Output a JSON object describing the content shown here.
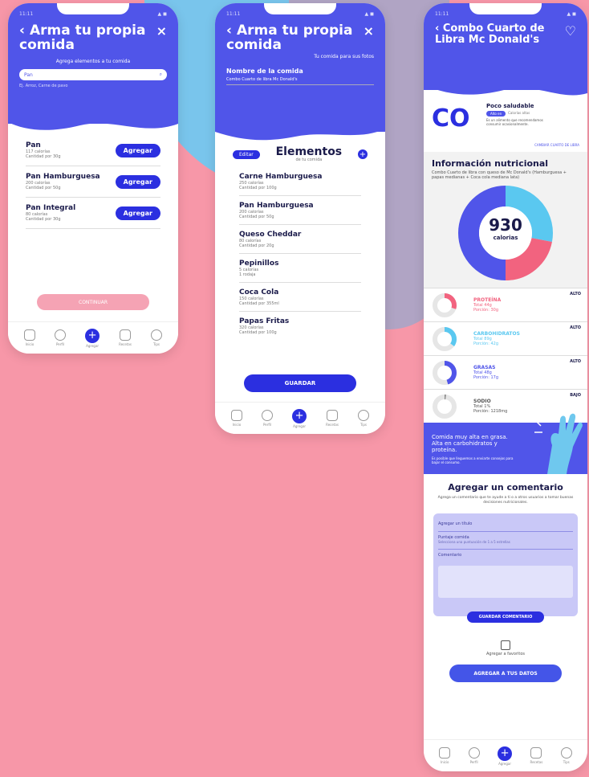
{
  "phone1": {
    "title": "Arma tu propia comida",
    "subtitle": "Agrega elementos a tu comida",
    "search_value": "Pan",
    "search_hint": "Ej. Arroz, Carne de pavo",
    "items": [
      {
        "name": "Pan",
        "meta1": "117 calorías",
        "meta2": "Cantidad por 30g",
        "button": "Agregar"
      },
      {
        "name": "Pan Hamburguesa",
        "meta1": "200 calorías",
        "meta2": "Cantidad por 50g",
        "button": "Agregar"
      },
      {
        "name": "Pan Integral",
        "meta1": "80 calorías",
        "meta2": "Cantidad por 30g",
        "button": "Agregar"
      }
    ],
    "continue_label": "CONTINUAR"
  },
  "phone2": {
    "title": "Arma tu propia comida",
    "subtitle": "Tu comida para sus fotos",
    "name_label": "Nombre de la comida",
    "name_value": "Combo Cuarto de libra Mc Donald's",
    "edit_label": "Editar",
    "list_title": "Elementos",
    "list_subtitle": "de tu comida",
    "items": [
      {
        "name": "Carne Hamburguesa",
        "meta1": "250 calorías",
        "meta2": "Cantidad por 100g"
      },
      {
        "name": "Pan Hamburguesa",
        "meta1": "200 calorías",
        "meta2": "Cantidad por 50g"
      },
      {
        "name": "Queso Cheddar",
        "meta1": "80 calorías",
        "meta2": "Cantidad por 20g"
      },
      {
        "name": "Pepinillos",
        "meta1": "5 calorías",
        "meta2": "1 rodaja"
      },
      {
        "name": "Coca Cola",
        "meta1": "150 calorías",
        "meta2": "Cantidad por 355ml"
      },
      {
        "name": "Papas Fritas",
        "meta1": "320 calorías",
        "meta2": "Cantidad por 100g"
      }
    ],
    "save_label": "GUARDAR"
  },
  "phone3": {
    "title": "Combo Cuarto de Libra Mc Donald's",
    "brand_text": "CO",
    "health_label": "Poco saludable",
    "health_badge": "Alto en",
    "health_badge2": "Calorías altas",
    "health_desc": "Es un alimento que recomendamos consumir ocasionalmente.",
    "edit_combo": "CAMBIAR CUARTO DE LIBRA",
    "info_title": "Información nutricional",
    "info_desc": "Combo Cuarto de libra con queso de Mc Donald's (Hamburguesa + papas medianas + Coca cola mediana lata)",
    "calories_value": "930",
    "calories_label": "calorias",
    "nutrients": [
      {
        "name": "PROTEÍNA",
        "line1": "Total 44g",
        "line2": "Porción: 30g",
        "level": "ALTO",
        "color": "#F2637F",
        "fraction": 0.3
      },
      {
        "name": "CARBOHIDRATOS",
        "line1": "Total 89g",
        "line2": "Porción: 42g",
        "level": "ALTO",
        "color": "#5AC8F0",
        "fraction": 0.35
      },
      {
        "name": "GRASAS",
        "line1": "Total 48g",
        "line2": "Porción: 17g",
        "level": "ALTO",
        "color": "#5055E9",
        "fraction": 0.45
      },
      {
        "name": "SODIO",
        "line1": "Total 1%",
        "line2": "Porción: 1218mg",
        "level": "BAJO",
        "color": "#888888",
        "fraction": 0.02
      }
    ],
    "donut": [
      {
        "value": 28,
        "color": "#5AC8F0"
      },
      {
        "value": 22,
        "color": "#F2637F"
      },
      {
        "value": 50,
        "color": "#5055E9"
      }
    ],
    "promo_title": "Comida muy alta en grasa. Alta en carbohidratos y proteína.",
    "promo_small": "Es posible que lleguemos a enviarte consejos para bajar el consumo.",
    "comment_title": "Agregar un comentario",
    "comment_desc": "Agrega un comentario que te ayude a ti o a otros usuarios a tomar buenas decisiones nutricionales.",
    "field_author": "Agregar un título",
    "field_rating": "Puntaje comida",
    "field_rating_hint": "Selecciona una puntuación de 1 a 5 estrellas",
    "field_comment": "Comentario",
    "comment_button": "GUARDAR COMENTARIO",
    "fav_label": "Agregar a favoritos",
    "data_button": "AGREGAR A TUS DATOS"
  },
  "nav": [
    "Inicio",
    "Perfil",
    "Agregar",
    "Recetas",
    "Tips"
  ]
}
